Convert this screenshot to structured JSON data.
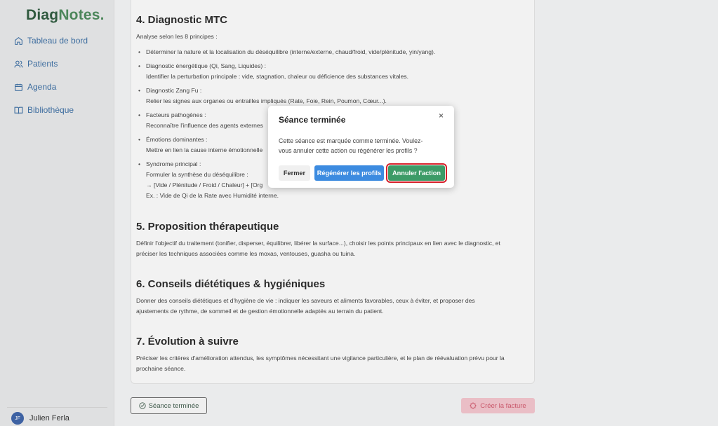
{
  "app": {
    "logo_part1": "Diag",
    "logo_part2": "Notes."
  },
  "sidebar": {
    "items": [
      {
        "label": "Tableau de bord",
        "icon": "home-icon"
      },
      {
        "label": "Patients",
        "icon": "users-icon"
      },
      {
        "label": "Agenda",
        "icon": "calendar-icon"
      },
      {
        "label": "Bibliothèque",
        "icon": "book-icon"
      }
    ],
    "user": {
      "initials": "JF",
      "name": "Julien Ferla"
    }
  },
  "sections": {
    "s4": {
      "title": "4. Diagnostic MTC",
      "intro": "Analyse selon les 8 principes :",
      "bullets": [
        {
          "line1": "Déterminer la nature et la localisation du déséquilibre (interne/externe, chaud/froid, vide/plénitude, yin/yang)."
        },
        {
          "line1": "Diagnostic énergétique (Qi, Sang, Liquides) :",
          "line2": "Identifier la perturbation principale : vide, stagnation, chaleur ou déficience des substances vitales."
        },
        {
          "line1": "Diagnostic Zang Fu :",
          "line2": "Relier les signes aux organes ou entrailles impliqués (Rate, Foie, Rein, Poumon, Cœur...)."
        },
        {
          "line1": "Facteurs pathogènes :",
          "line2": "Reconnaître l'influence des agents externes"
        },
        {
          "line1": "Émotions dominantes :",
          "line2": "Mettre en lien la cause interne émotionnelle"
        },
        {
          "line1": "Syndrome principal :",
          "line2": "Formuler la synthèse du déséquilibre :",
          "line3": "→ [Vide / Plénitude / Froid / Chaleur] + [Org",
          "line4": "Ex. : Vide de Qi de la Rate avec Humidité interne."
        }
      ]
    },
    "s5": {
      "title": "5. Proposition thérapeutique",
      "text_line1": "Définir l'objectif du traitement (tonifier, disperser, équilibrer, libérer la surface...), choisir les points principaux en lien avec le diagnostic, et",
      "text_line2": "préciser les techniques associées comme les moxas, ventouses, guasha ou tuina."
    },
    "s6": {
      "title": "6. Conseils diététiques & hygiéniques",
      "text_line1": "Donner des conseils diététiques et d'hygiène de vie : indiquer les saveurs et aliments favorables, ceux à éviter, et proposer des",
      "text_line2": "ajustements de rythme, de sommeil et de gestion émotionnelle adaptés au terrain du patient."
    },
    "s7": {
      "title": "7. Évolution à suivre",
      "text_line1": "Préciser les critères d'amélioration attendus, les symptômes nécessitant une vigilance particulière, et le plan de réévaluation prévu pour la",
      "text_line2": "prochaine séance."
    }
  },
  "footer": {
    "done_label": "Séance terminée",
    "invoice_label": "Créer la facture"
  },
  "modal": {
    "title": "Séance terminée",
    "close": "×",
    "text_line1": "Cette séance est marquée comme terminée. Voulez-",
    "text_line2": "vous annuler cette action ou régénérer les profils ?",
    "btn_close": "Fermer",
    "btn_regen": "Régénérer les profils",
    "btn_cancel": "Annuler l'action"
  },
  "colors": {
    "nav_link": "#3d6fa3",
    "primary_blue": "#3c8be0",
    "success_green": "#3c9b67",
    "highlight_red": "#d6202a",
    "invoice_pink": "#f2c4cc"
  }
}
